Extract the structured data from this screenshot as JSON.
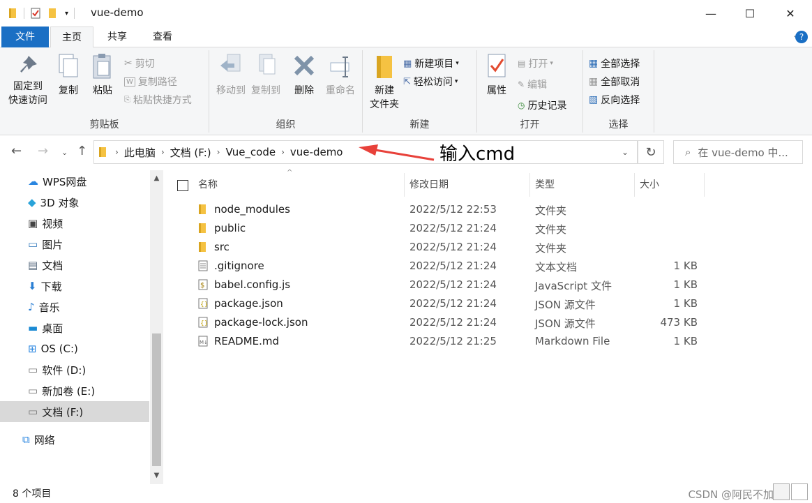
{
  "window": {
    "title": "vue-demo",
    "minimize": "—",
    "maximize": "☐",
    "close": "✕"
  },
  "tabs": [
    {
      "label": "文件"
    },
    {
      "label": "主页"
    },
    {
      "label": "共享"
    },
    {
      "label": "查看"
    }
  ],
  "ribbon": {
    "clipboard": {
      "group_label": "剪贴板",
      "pin_l1": "固定到",
      "pin_l2": "快速访问",
      "copy": "复制",
      "paste": "粘贴",
      "cut": "剪切",
      "copy_path": "复制路径",
      "paste_shortcut": "粘贴快捷方式"
    },
    "organize": {
      "group_label": "组织",
      "move_to": "移动到",
      "copy_to": "复制到",
      "delete": "删除",
      "rename": "重命名"
    },
    "new": {
      "group_label": "新建",
      "new_folder_l1": "新建",
      "new_folder_l2": "文件夹",
      "new_item": "新建项目",
      "easy_access": "轻松访问"
    },
    "open": {
      "group_label": "打开",
      "properties": "属性",
      "open": "打开",
      "edit": "编辑",
      "history": "历史记录"
    },
    "select": {
      "group_label": "选择",
      "select_all": "全部选择",
      "select_none": "全部取消",
      "invert": "反向选择"
    }
  },
  "address": {
    "crumbs": [
      "此电脑",
      "文档 (F:)",
      "Vue_code",
      "vue-demo"
    ],
    "search_placeholder": "在 vue-demo 中..."
  },
  "annotation": "输入cmd",
  "sidebar": {
    "items": [
      {
        "label": "WPS网盘",
        "icon": "cloud-icon"
      },
      {
        "label": "3D 对象",
        "icon": "cube-icon"
      },
      {
        "label": "视频",
        "icon": "film-icon"
      },
      {
        "label": "图片",
        "icon": "picture-icon"
      },
      {
        "label": "文档",
        "icon": "document-icon"
      },
      {
        "label": "下载",
        "icon": "download-icon"
      },
      {
        "label": "音乐",
        "icon": "music-icon"
      },
      {
        "label": "桌面",
        "icon": "desktop-icon"
      },
      {
        "label": "OS (C:)",
        "icon": "windows-drive-icon"
      },
      {
        "label": "软件 (D:)",
        "icon": "drive-icon"
      },
      {
        "label": "新加卷 (E:)",
        "icon": "drive-icon"
      },
      {
        "label": "文档 (F:)",
        "icon": "drive-icon"
      },
      {
        "label": "网络",
        "icon": "network-icon"
      }
    ]
  },
  "columns": {
    "name": "名称",
    "date": "修改日期",
    "type": "类型",
    "size": "大小"
  },
  "files": [
    {
      "name": "node_modules",
      "date": "2022/5/12 22:53",
      "type": "文件夹",
      "size": "",
      "icon": "folder-icon"
    },
    {
      "name": "public",
      "date": "2022/5/12 21:24",
      "type": "文件夹",
      "size": "",
      "icon": "folder-icon"
    },
    {
      "name": "src",
      "date": "2022/5/12 21:24",
      "type": "文件夹",
      "size": "",
      "icon": "folder-icon"
    },
    {
      "name": ".gitignore",
      "date": "2022/5/12 21:24",
      "type": "文本文档",
      "size": "1 KB",
      "icon": "text-file-icon"
    },
    {
      "name": "babel.config.js",
      "date": "2022/5/12 21:24",
      "type": "JavaScript 文件",
      "size": "1 KB",
      "icon": "js-file-icon"
    },
    {
      "name": "package.json",
      "date": "2022/5/12 21:24",
      "type": "JSON 源文件",
      "size": "1 KB",
      "icon": "json-file-icon"
    },
    {
      "name": "package-lock.json",
      "date": "2022/5/12 21:24",
      "type": "JSON 源文件",
      "size": "473 KB",
      "icon": "json-file-icon"
    },
    {
      "name": "README.md",
      "date": "2022/5/12 21:25",
      "type": "Markdown File",
      "size": "1 KB",
      "icon": "markdown-file-icon"
    }
  ],
  "status": {
    "count": "8 个项目"
  },
  "watermark": "CSDN @阿民不加班",
  "colors": {
    "accent": "#1a6fc4",
    "folder": "#f5c242",
    "arrow": "#e8413a"
  }
}
